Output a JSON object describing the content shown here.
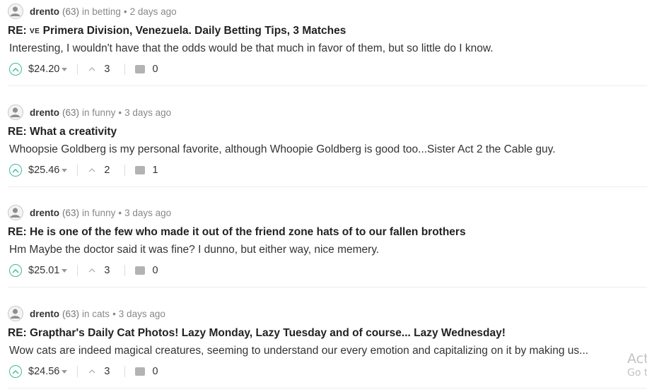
{
  "comments": [
    {
      "author": "drento",
      "reputation": "(63)",
      "community_prefix": "in",
      "community": "betting",
      "time": "2 days ago",
      "title_prefix": "RE: ",
      "title_flag": "VE",
      "title": "Primera Division, Venezuela. Daily Betting Tips, 3 Matches",
      "body": "Interesting, I wouldn't have that the odds would be that much in favor of them, but so little do I know.",
      "payout": "$24.20",
      "votes": "3",
      "replies": "0"
    },
    {
      "author": "drento",
      "reputation": "(63)",
      "community_prefix": "in",
      "community": "funny",
      "time": "3 days ago",
      "title_prefix": "RE: ",
      "title_flag": "",
      "title": "What a creativity",
      "body": "Whoopsie Goldberg is my personal favorite, although Whoopie Goldberg is good too...Sister Act 2 the Cable guy.",
      "payout": "$25.46",
      "votes": "2",
      "replies": "1"
    },
    {
      "author": "drento",
      "reputation": "(63)",
      "community_prefix": "in",
      "community": "funny",
      "time": "3 days ago",
      "title_prefix": "RE: ",
      "title_flag": "",
      "title": "He is one of the few who made it out of the friend zone hats of to our fallen brothers",
      "body": "Hm Maybe the doctor said it was fine? I dunno, but either way, nice memery.",
      "payout": "$25.01",
      "votes": "3",
      "replies": "0"
    },
    {
      "author": "drento",
      "reputation": "(63)",
      "community_prefix": "in",
      "community": "cats",
      "time": "3 days ago",
      "title_prefix": "RE: ",
      "title_flag": "",
      "title": "Grapthar's Daily Cat Photos! Lazy Monday, Lazy Tuesday and of course... Lazy Wednesday!",
      "body": "Wow cats are indeed magical creatures, seeming to understand our every emotion and capitalizing on it by making us...",
      "payout": "$24.56",
      "votes": "3",
      "replies": "0"
    }
  ],
  "watermark": {
    "line1": "Act",
    "line2": "Go t"
  },
  "colors": {
    "upvote_accent": "#3fb89a",
    "divider": "#eeeeee"
  },
  "icons": {
    "avatar": "user-avatar-icon",
    "upvote": "upvote-chevron-circle-icon",
    "payout_menu": "caret-down-icon",
    "votes": "chevron-up-icon",
    "replies": "speech-bubble-icon"
  }
}
